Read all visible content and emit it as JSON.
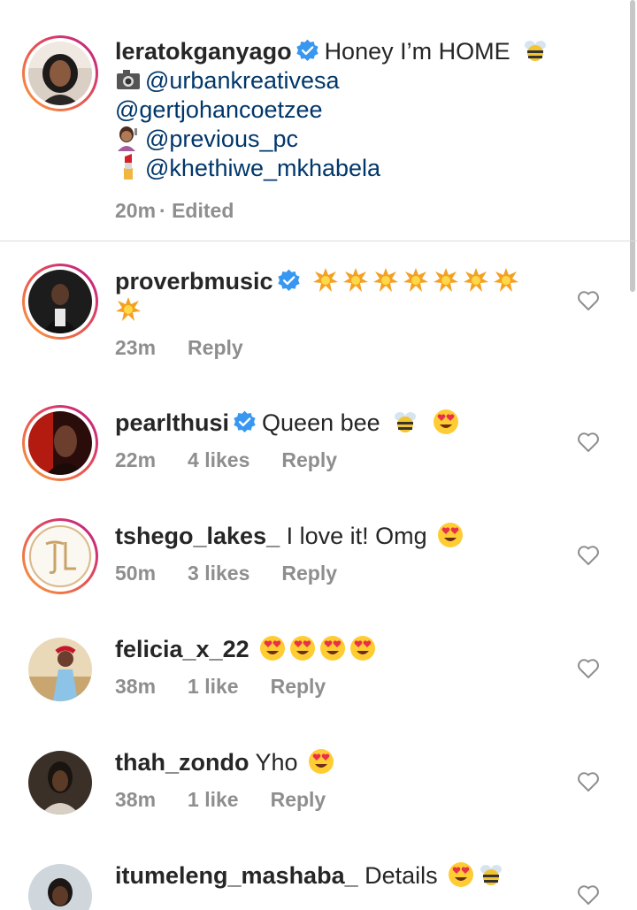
{
  "caption": {
    "username": "leratokganyago",
    "text": "Honey I’m HOME",
    "lines": [
      {
        "icon": "camera-icon",
        "mention": "@urbankreativesa"
      },
      {
        "icon": "",
        "mention": "@gertjohancoetzee"
      },
      {
        "icon": "haircut-icon",
        "mention": "@previous_pc"
      },
      {
        "icon": "lipstick-icon",
        "mention": "@khethiwe_mkhabela"
      }
    ],
    "time": "20m",
    "edited": "· Edited"
  },
  "comments": [
    {
      "username": "proverbmusic",
      "verified": true,
      "text": "",
      "emojis": [
        "collision",
        "collision",
        "collision",
        "collision",
        "collision",
        "collision",
        "collision",
        "collision"
      ],
      "time": "23m",
      "likes": "",
      "reply": "Reply"
    },
    {
      "username": "pearlthusi",
      "verified": true,
      "text": "Queen bee",
      "emojis": [
        "bee",
        "heart-eyes"
      ],
      "time": "22m",
      "likes": "4 likes",
      "reply": "Reply"
    },
    {
      "username": "tshego_lakes_",
      "verified": false,
      "text": "I love it! Omg",
      "emojis": [
        "heart-eyes"
      ],
      "time": "50m",
      "likes": "3 likes",
      "reply": "Reply"
    },
    {
      "username": "felicia_x_22",
      "verified": false,
      "text": "",
      "emojis": [
        "heart-eyes",
        "heart-eyes",
        "heart-eyes",
        "heart-eyes"
      ],
      "time": "38m",
      "likes": "1 like",
      "reply": "Reply"
    },
    {
      "username": "thah_zondo",
      "verified": false,
      "text": "Yho",
      "emojis": [
        "heart-eyes"
      ],
      "time": "38m",
      "likes": "1 like",
      "reply": "Reply"
    },
    {
      "username": "itumeleng_mashaba_",
      "verified": false,
      "text": "Details",
      "emojis": [
        "heart-eyes",
        "bee"
      ],
      "time": "",
      "likes": "",
      "reply": ""
    }
  ],
  "colors": {
    "mention": "#00376b",
    "verified": "#3897f0",
    "meta": "#8e8e8e"
  }
}
